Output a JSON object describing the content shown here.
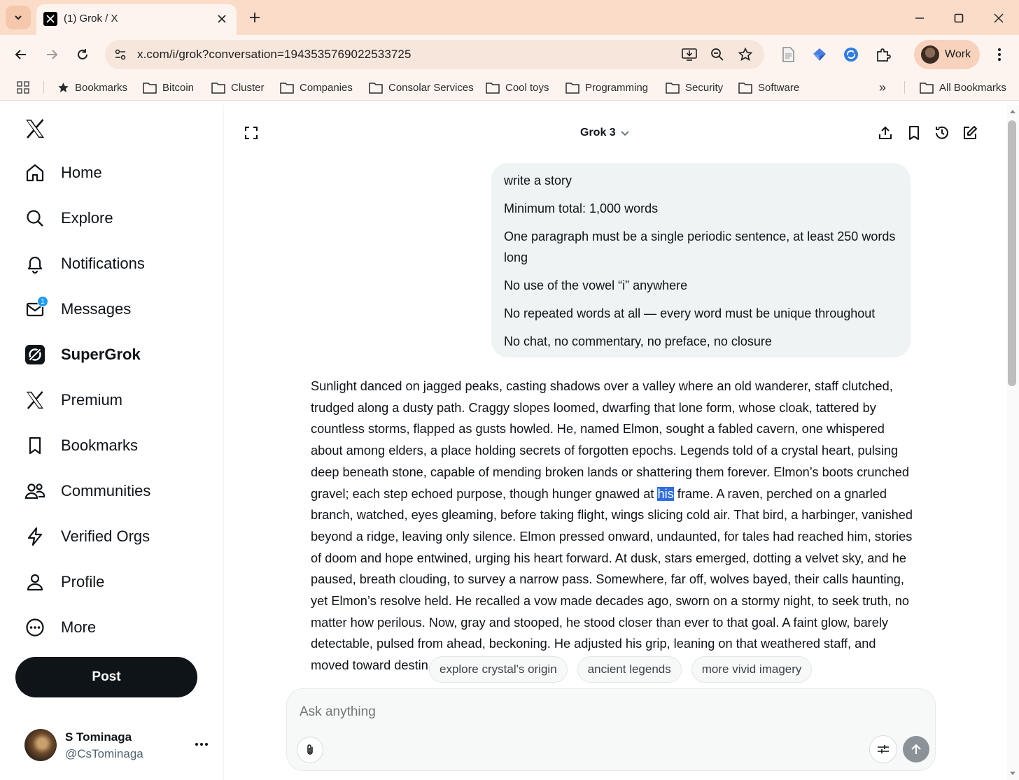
{
  "browser": {
    "tab_title": "(1) Grok / X",
    "url": "x.com/i/grok?conversation=1943535769022533725",
    "profile_label": "Work",
    "bookmarks": [
      "Bookmarks",
      "Bitcoin",
      "Cluster",
      "Companies",
      "Consolar Services",
      "Cool toys",
      "Programming",
      "Security",
      "Software"
    ],
    "all_bookmarks": "All Bookmarks",
    "overflow_glyph": "»"
  },
  "sidebar": {
    "nav": [
      {
        "label": "Home",
        "icon": "home-icon"
      },
      {
        "label": "Explore",
        "icon": "search-icon"
      },
      {
        "label": "Notifications",
        "icon": "bell-icon"
      },
      {
        "label": "Messages",
        "icon": "envelope-icon",
        "badge": "1"
      },
      {
        "label": "SuperGrok",
        "icon": "grok-icon"
      },
      {
        "label": "Premium",
        "icon": "x-icon"
      },
      {
        "label": "Bookmarks",
        "icon": "bookmark-icon"
      },
      {
        "label": "Communities",
        "icon": "people-icon"
      },
      {
        "label": "Verified Orgs",
        "icon": "lightning-icon"
      },
      {
        "label": "Profile",
        "icon": "person-icon"
      },
      {
        "label": "More",
        "icon": "more-circle-icon"
      }
    ],
    "post_label": "Post",
    "account": {
      "name": "S Tominaga",
      "handle": "@CsTominaga"
    }
  },
  "grok": {
    "model": "Grok 3",
    "user_prompt": [
      "write a story",
      "Minimum total: 1,000 words",
      "One paragraph must be a single periodic sentence, at least 250 words long",
      "No use of the vowel “i” anywhere",
      "No repeated words at all — every word must be unique throughout",
      "No chat, no commentary, no preface, no closure"
    ],
    "reply_before": "Sunlight danced on jagged peaks, casting shadows over a valley where an old wanderer, staff clutched, trudged along a dusty path. Craggy slopes loomed, dwarfing that lone form, whose cloak, tattered by countless storms, flapped as gusts howled. He, named Elmon, sought a fabled cavern, one whispered about among elders, a place holding secrets of forgotten epochs. Legends told of a crystal heart, pulsing deep beneath stone, capable of mending broken lands or shattering them forever. Elmon’s boots crunched gravel; each step echoed purpose, though hunger gnawed at ",
    "reply_highlight": "his",
    "reply_after": " frame. A raven, perched on a gnarled branch, watched, eyes gleaming, before taking flight, wings slicing cold air. That bird, a harbinger, vanished beyond a ridge, leaving only silence. Elmon pressed onward, undaunted, for tales had reached him, stories of doom and hope entwined, urging his heart forward. At dusk, stars emerged, dotting a velvet sky, and he paused, breath clouding, to survey a narrow pass. Somewhere, far off, wolves bayed, their calls haunting, yet Elmon’s resolve held. He recalled a vow made decades ago, sworn on a stormy night, to seek truth, no matter how perilous. Now, gray and stooped, he stood closer than ever to that goal. A faint glow, barely detectable, pulsed from ahead, beckoning. He adjusted his grip, leaning on that weathered staff, and moved toward destin",
    "suggestions": [
      "explore crystal's origin",
      "ancient legends",
      "more vivid imagery"
    ],
    "composer_placeholder": "Ask anything"
  }
}
